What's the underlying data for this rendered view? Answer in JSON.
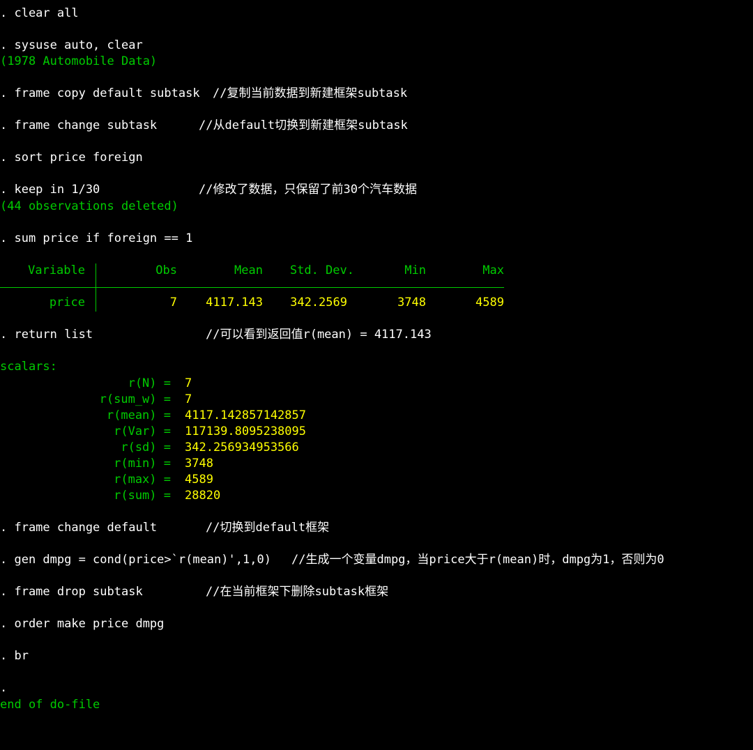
{
  "console": {
    "cmd_clear_all": ". clear all",
    "cmd_sysuse": ". sysuse auto, clear",
    "out_sysuse": "(1978 Automobile Data)",
    "cmd_frame_copy": ". frame copy default subtask",
    "cmt_frame_copy": "//复制当前数据到新建框架subtask",
    "cmd_frame_change": ". frame change subtask",
    "cmt_frame_change": "//从default切换到新建框架subtask",
    "cmd_sort": ". sort price foreign",
    "cmd_keep": ". keep in 1/30",
    "cmt_keep": "//修改了数据，只保留了前30个汽车数据",
    "out_keep": "(44 observations deleted)",
    "cmd_sum": ". sum price if foreign == 1",
    "summary_table": {
      "headers": [
        "Variable",
        "Obs",
        "Mean",
        "Std. Dev.",
        "Min",
        "Max"
      ],
      "row": {
        "variable": "price",
        "obs": "7",
        "mean": "4117.143",
        "sd": "342.2569",
        "min": "3748",
        "max": "4589"
      }
    },
    "cmd_return_list": ". return list",
    "cmt_return_list": "//可以看到返回值r(mean) = 4117.143",
    "scalars_heading": "scalars:",
    "scalars": [
      {
        "name": "r(N) =",
        "value": "7"
      },
      {
        "name": "r(sum_w) =",
        "value": "7"
      },
      {
        "name": "r(mean) =",
        "value": "4117.142857142857"
      },
      {
        "name": "r(Var) =",
        "value": "117139.8095238095"
      },
      {
        "name": "r(sd) =",
        "value": "342.256934953566"
      },
      {
        "name": "r(min) =",
        "value": "3748"
      },
      {
        "name": "r(max) =",
        "value": "4589"
      },
      {
        "name": "r(sum) =",
        "value": "28820"
      }
    ],
    "cmd_frame_change_default": ". frame change default",
    "cmt_frame_change_default": "//切换到default框架",
    "cmd_gen": ". gen dmpg = cond(price>`r(mean)',1,0)",
    "cmt_gen": "//生成一个变量dmpg，当price大于r(mean)时，dmpg为1，否则为0",
    "cmd_frame_drop": ". frame drop subtask",
    "cmt_frame_drop": "//在当前框架下删除subtask框架",
    "cmd_order": ". order make price dmpg",
    "cmd_br": ". br",
    "prompt_dot": ".",
    "end_do_file": "end of do-file"
  },
  "colors": {
    "background": "#000000",
    "command_text": "#ffffff",
    "result_green": "#00cc00",
    "value_yellow": "#ffff00"
  }
}
